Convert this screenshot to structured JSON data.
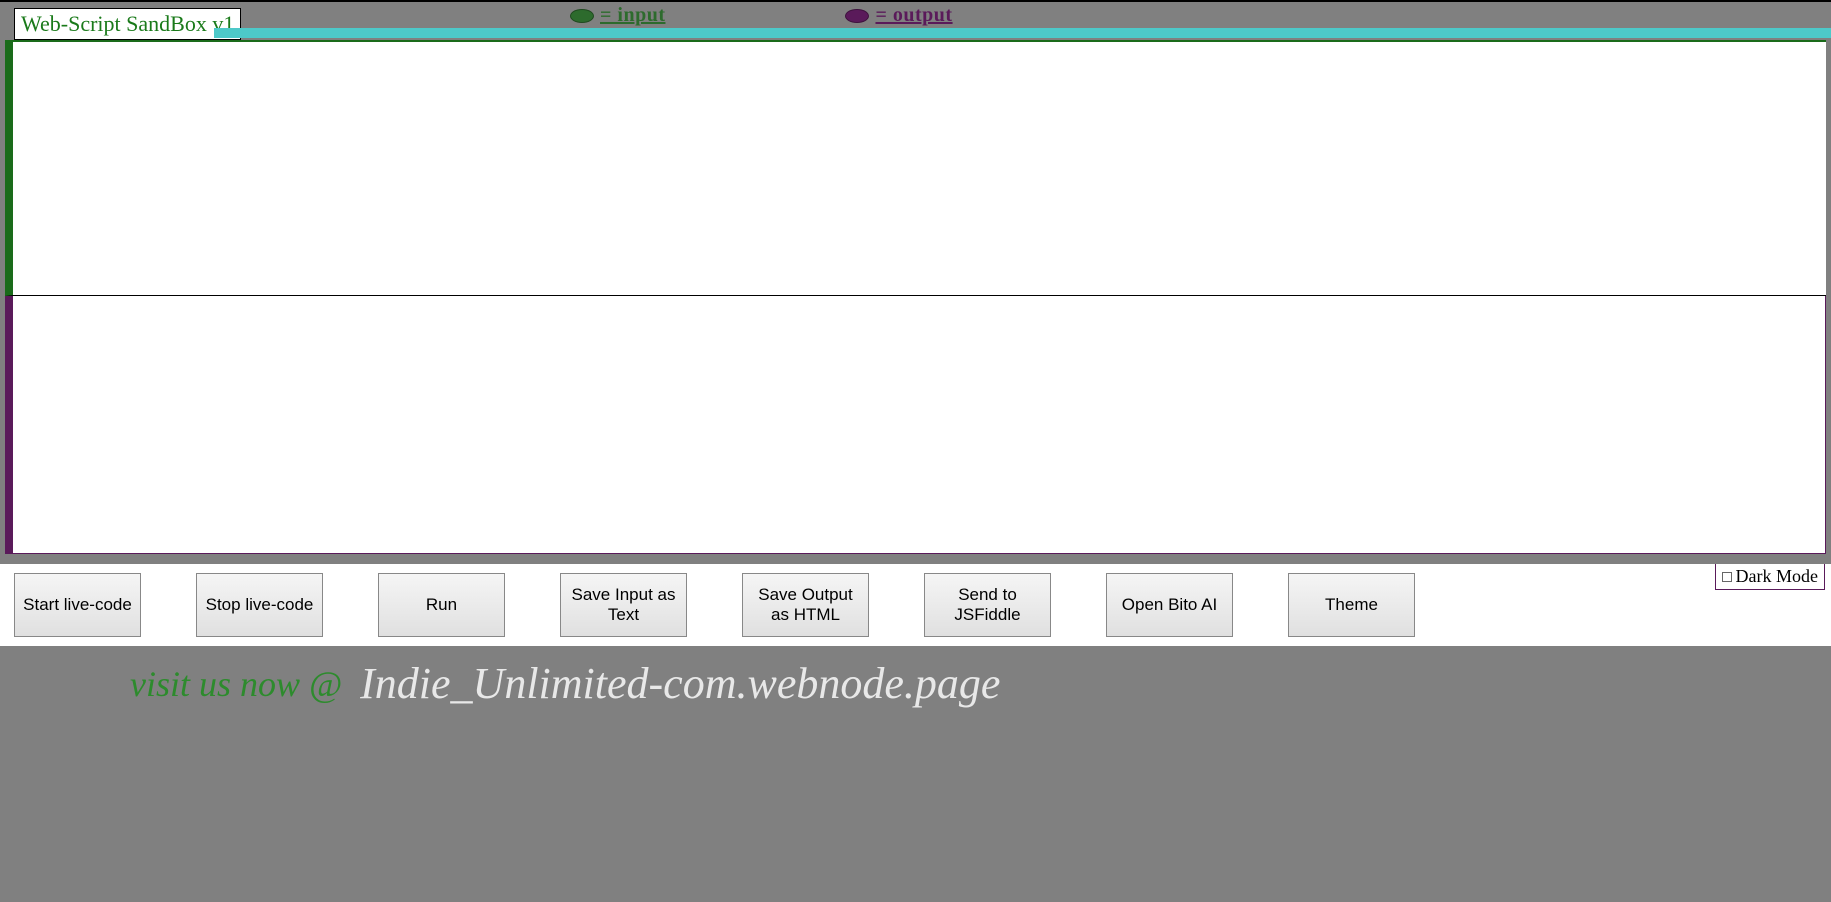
{
  "header": {
    "title": "Web-Script SandBox v1",
    "legend": {
      "input_label": "= input",
      "output_label": "= output"
    }
  },
  "panels": {
    "input_value": "",
    "output_value": ""
  },
  "buttons": [
    "Start live-code",
    "Stop live-code",
    "Run",
    "Save Input as Text",
    "Save Output as HTML",
    "Send to JSFiddle",
    "Open Bito AI",
    "Theme"
  ],
  "darkmode_label": "Dark Mode",
  "footer": {
    "visit": "visit us now @",
    "site": "Indie_Unlimited-com.webnode.page"
  }
}
